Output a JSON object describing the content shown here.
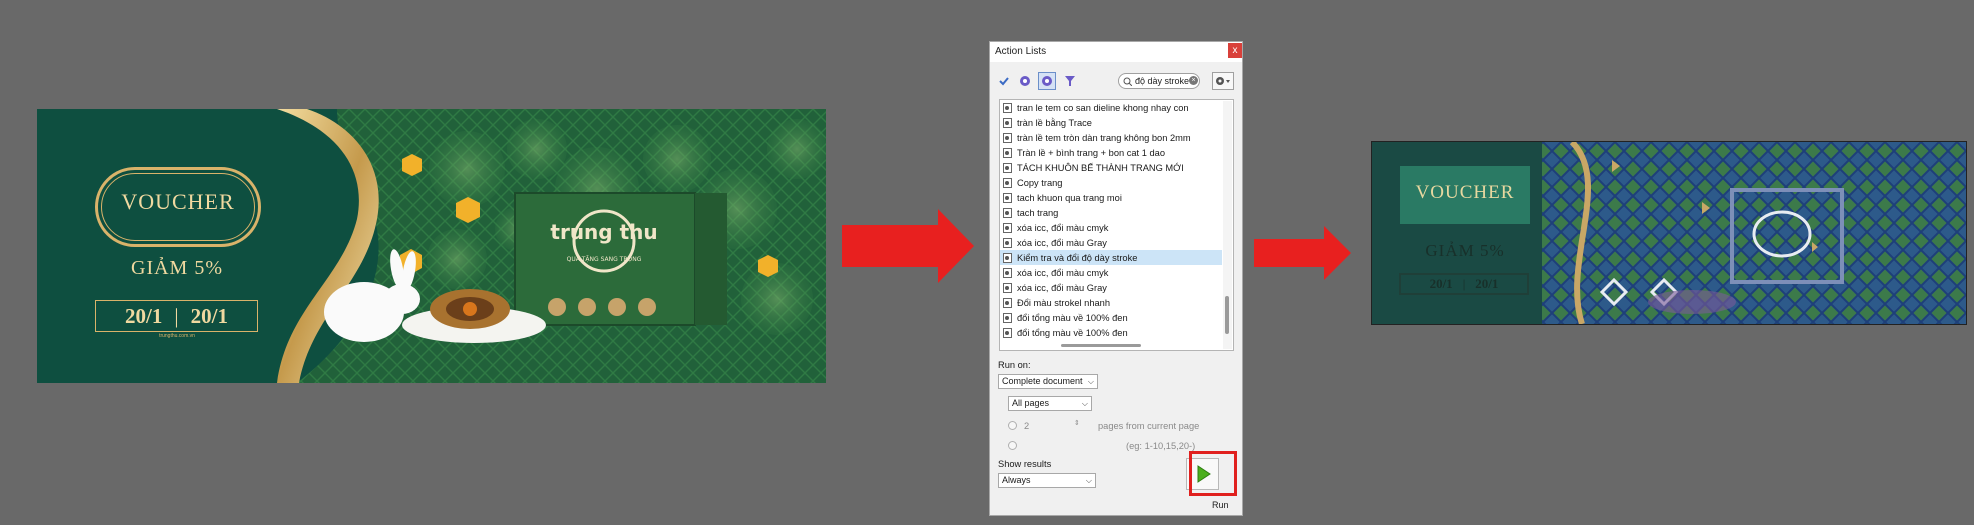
{
  "left_image": {
    "voucher_label": "VOUCHER",
    "discount": "GIẢM 5%",
    "date_start": "20/1",
    "date_end": "20/1",
    "fine_print": "trungthu.com.vn",
    "box_brand": "trung thu",
    "box_subtitle": "QUÀ TẶNG SANG TRỌNG"
  },
  "dialog": {
    "title": "Action Lists",
    "close_label": "x",
    "search_value": "độ dày stroke",
    "actions": [
      "tran le tem co san dieline khong nhay con",
      "tràn lề bằng Trace",
      "tràn lề tem tròn  dàn trang không bon 2mm",
      "Tràn lề + bình trang + bon cat 1 dao",
      "TÁCH KHUÔN BẾ THÀNH TRANG MỚI",
      "Copy trang",
      "tach khuon qua trang moi",
      "tach trang",
      "xóa icc, đổi màu cmyk",
      "xóa icc, đổi màu Gray",
      "Kiểm tra và đổi độ dày stroke",
      "xóa icc, đổi màu cmyk",
      "xóa icc, đổi màu Gray",
      "Đổi màu strokel nhanh",
      "đổi tổng màu về 100% đen",
      "đổi tổng màu về 100% đen"
    ],
    "selected_index": 10,
    "run_on_label": "Run on:",
    "run_on_value": "Complete document",
    "pages_value": "All pages",
    "pages_count": "2",
    "pages_from_label": "pages from current page",
    "range_hint": "(eg: 1-10,15,20-)",
    "show_results_label": "Show results",
    "show_results_value": "Always",
    "run_label": "Run"
  },
  "right_image": {
    "voucher_label": "VOUCHER",
    "discount": "GIẢM 5%",
    "date_start": "20/1",
    "date_end": "20/1"
  },
  "colors": {
    "arrow": "#e8201f",
    "background": "#696969",
    "voucher_green": "#0e4f40",
    "gold": "#d9b36a",
    "selection": "#cce4f7",
    "run_green": "#4caf1e"
  }
}
